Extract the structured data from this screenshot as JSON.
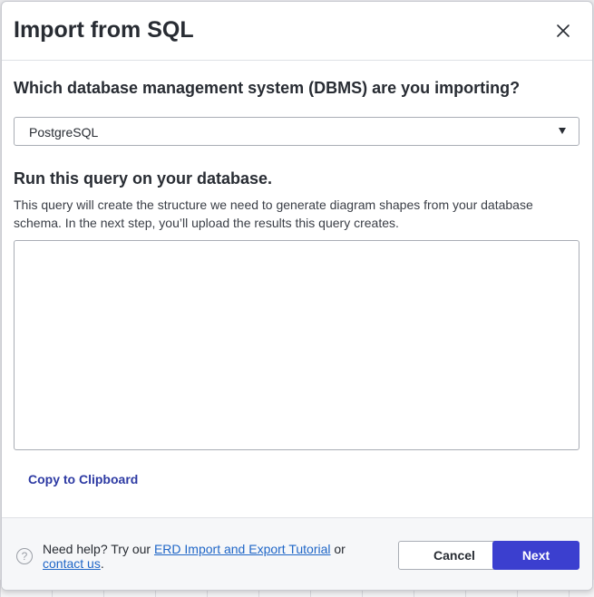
{
  "dialog": {
    "title": "Import from SQL",
    "close_icon": "close-icon"
  },
  "dbms": {
    "question": "Which database management system (DBMS) are you importing?",
    "selected": "PostgreSQL",
    "caret_icon": "caret-down-icon"
  },
  "query": {
    "heading": "Run this query on your database.",
    "description": "This query will create the structure we need to generate diagram shapes from your database schema. In the next step, you’ll upload the results this query creates.",
    "value": "",
    "copy_label": "Copy to Clipboard"
  },
  "footer": {
    "help_icon": "help-icon",
    "help_prefix": "Need help? Try our ",
    "tutorial_link": "ERD Import and Export Tutorial",
    "help_middle": " or ",
    "contact_link": "contact us",
    "help_suffix": ".",
    "cancel_label": "Cancel",
    "next_label": "Next"
  },
  "colors": {
    "primary": "#3b3fcf",
    "link": "#1f66c7",
    "copy_link": "#2d3aa3"
  }
}
